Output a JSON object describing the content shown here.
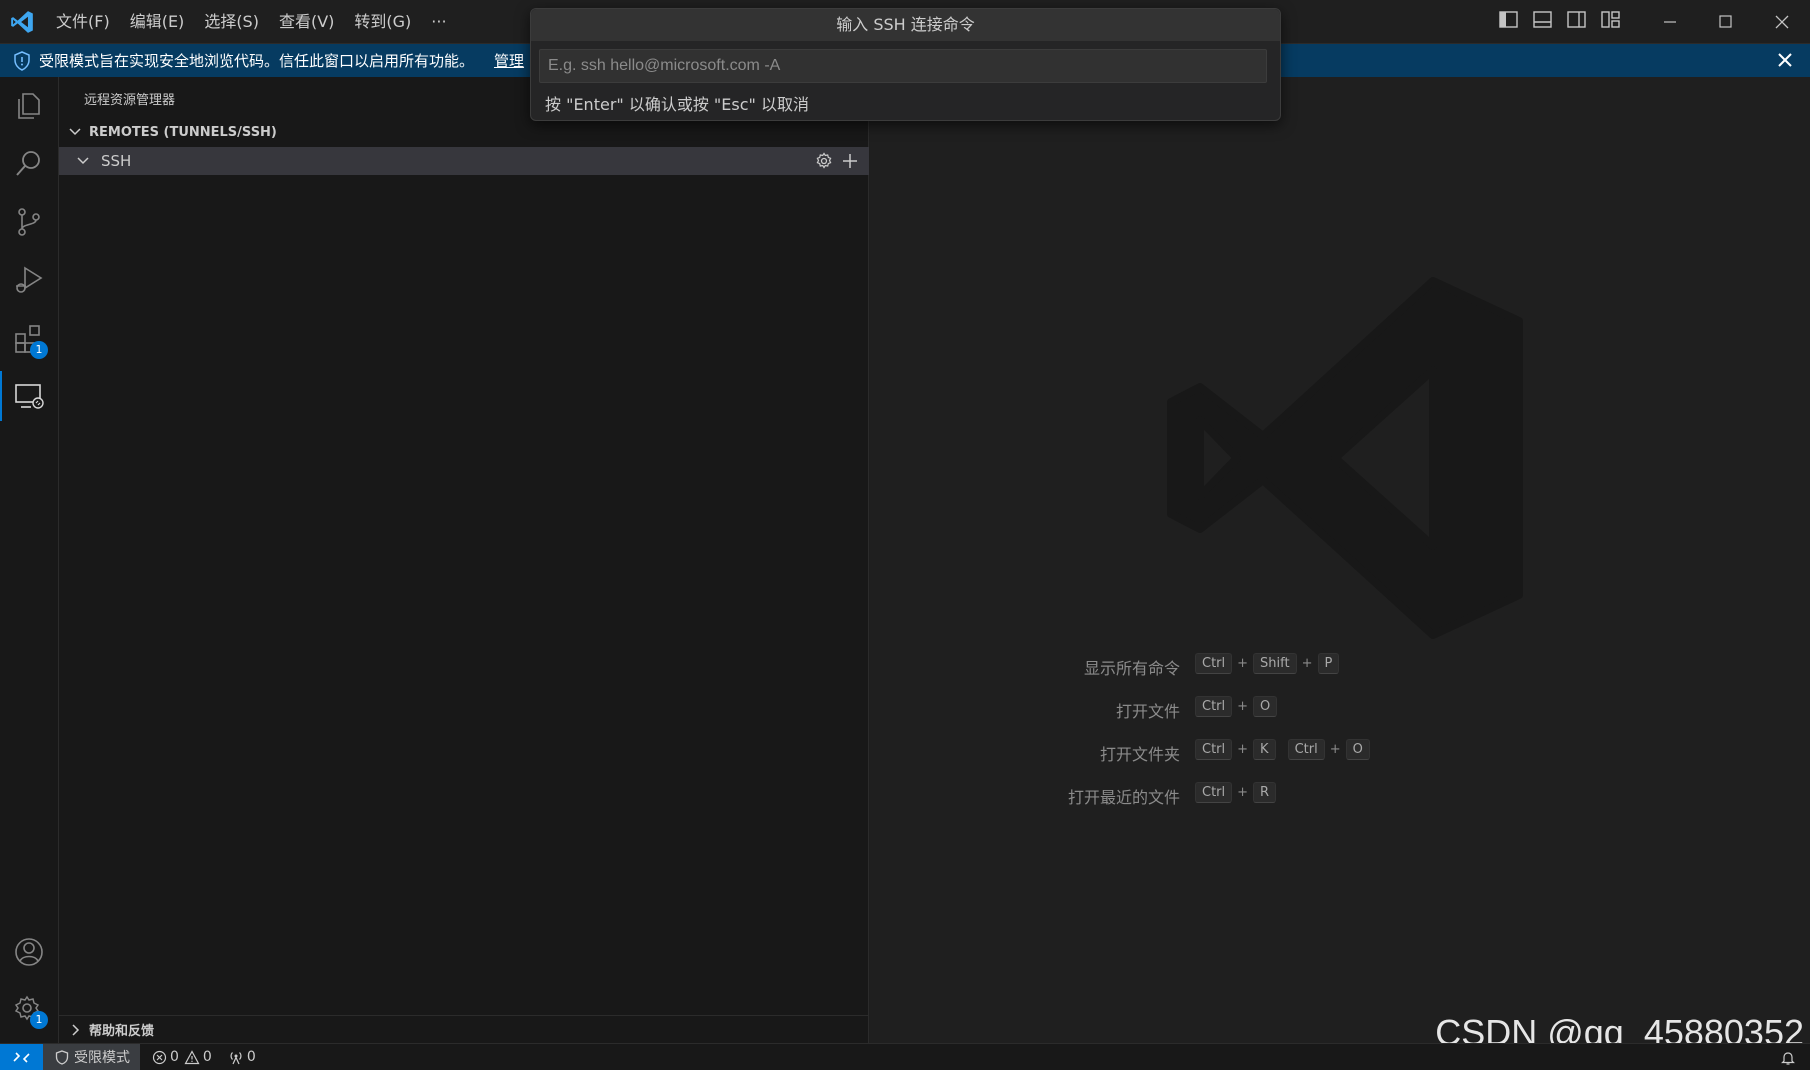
{
  "titlebar": {
    "menu": [
      "文件(F)",
      "编辑(E)",
      "选择(S)",
      "查看(V)",
      "转到(G)",
      "···"
    ]
  },
  "banner": {
    "message": "受限模式旨在实现安全地浏览代码。信任此窗口以启用所有功能。",
    "manage": "管理"
  },
  "quick_input": {
    "title": "输入 SSH 连接命令",
    "placeholder": "E.g. ssh hello@microsoft.com -A",
    "hint": "按 \"Enter\" 以确认或按 \"Esc\" 以取消"
  },
  "activity_bar": {
    "extensions_badge": "1",
    "settings_badge": "1"
  },
  "sidebar": {
    "title": "远程资源管理器",
    "section": "REMOTES (TUNNELS/SSH)",
    "ssh_label": "SSH",
    "help": "帮助和反馈"
  },
  "editor": {
    "shortcuts": [
      {
        "label": "显示所有命令",
        "keys": [
          [
            "Ctrl",
            "Shift",
            "P"
          ]
        ]
      },
      {
        "label": "打开文件",
        "keys": [
          [
            "Ctrl",
            "O"
          ]
        ]
      },
      {
        "label": "打开文件夹",
        "keys": [
          [
            "Ctrl",
            "K"
          ],
          [
            "Ctrl",
            "O"
          ]
        ]
      },
      {
        "label": "打开最近的文件",
        "keys": [
          [
            "Ctrl",
            "R"
          ]
        ]
      }
    ],
    "watermark_text": "CSDN @qq_45880352"
  },
  "statusbar": {
    "restricted_mode": "受限模式",
    "errors": "0",
    "warnings": "0",
    "ports": "0"
  },
  "colors": {
    "accent": "#0078d4",
    "banner": "#063b61"
  }
}
